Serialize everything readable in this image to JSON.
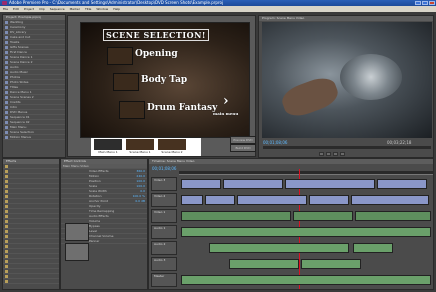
{
  "app": {
    "title": "Adobe Premiere Pro - C:\\Documents and Settings\\Administrator\\Desktop\\DVD Screen Shots\\Example.prproj"
  },
  "menu": [
    "File",
    "Edit",
    "Project",
    "Clip",
    "Sequence",
    "Marker",
    "Title",
    "Window",
    "Help"
  ],
  "project": {
    "tab": "Project: Example.prproj",
    "items": [
      "Wedding",
      "Ceremony",
      "DV_Library",
      "Cake and Cut",
      "Toasts",
      "Gifts Scenes",
      "First Dance",
      "Scene Dance 1",
      "Scene Dance 2",
      "Audio",
      "Audio Music",
      "Photos",
      "Photo Slides",
      "Titles",
      "Dance Menu 1",
      "Scene Scenes 2",
      "Credits",
      "Intro",
      "DVD Menus",
      "Sequence 01",
      "Sequence 02",
      "Main Menu",
      "Scene Selection",
      "Motion Menus"
    ]
  },
  "dvd": {
    "heading": "SCENE SELECTION!",
    "buttons": [
      "Opening",
      "Body Tap",
      "Drum Fantasy"
    ],
    "main_menu": "main menu",
    "thumb_labels": [
      "Main Menu 1",
      "Scene Menu 1",
      "Scene Menu 2"
    ],
    "side_buttons": [
      "Preview DVD",
      "Build DVD"
    ]
  },
  "program": {
    "tab": "Program: Scene Menu Video",
    "timecode_left": "00;01;08;06",
    "timecode_right": "00;03;22;18"
  },
  "effects": {
    "tab": "Effect Controls",
    "clip": "Main Menu Video",
    "props": [
      "Video Effects",
      "Motion",
      "Position",
      "Scale",
      "Scale Width",
      "Rotation",
      "Anchor Point",
      "Opacity",
      "Time Remapping",
      "Audio Effects",
      "Volume",
      "Bypass",
      "Level",
      "Channel Volume",
      "Panner"
    ],
    "values": [
      "360.0",
      "240.0",
      "100.0",
      "100.0",
      "0.0",
      "100.0 %",
      "0.0 dB"
    ]
  },
  "timeline": {
    "tab": "Timeline: Scene Menu Video",
    "timecode": "00;01;08;06",
    "tracks": [
      "Video 3",
      "Video 2",
      "Video 1",
      "Audio 1",
      "Audio 2",
      "Audio 3",
      "Master"
    ]
  }
}
